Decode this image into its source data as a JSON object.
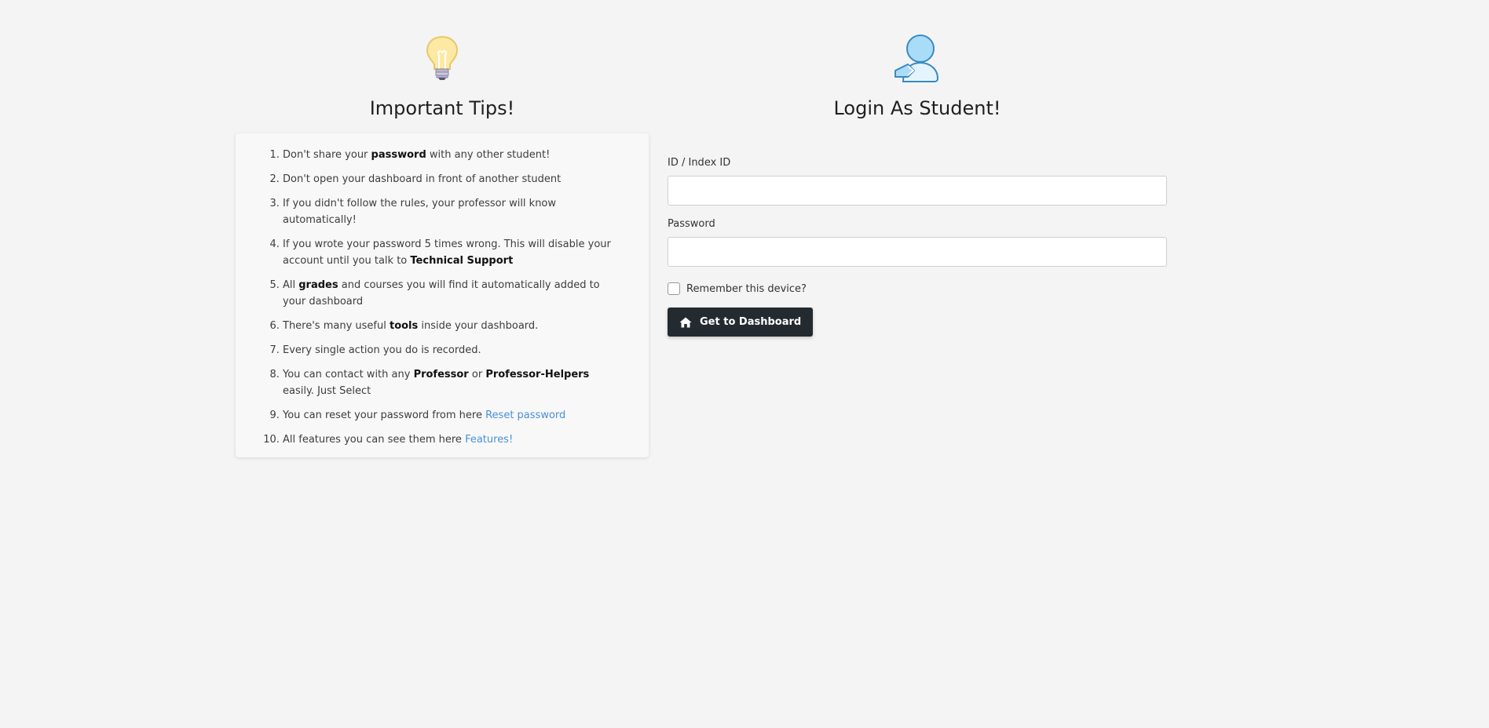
{
  "tips": {
    "title": "Important Tips!",
    "items": [
      {
        "parts": [
          {
            "t": "Don't share your "
          },
          {
            "t": "password",
            "b": true
          },
          {
            "t": " with any other student!"
          }
        ]
      },
      {
        "parts": [
          {
            "t": "Don't open your dashboard in front of another student"
          }
        ]
      },
      {
        "parts": [
          {
            "t": "If you didn't follow the rules, your professor will know automatically!"
          }
        ]
      },
      {
        "parts": [
          {
            "t": "If you wrote your password 5 times wrong. This will disable your account until you talk to "
          },
          {
            "t": "Technical Support",
            "b": true
          }
        ]
      },
      {
        "parts": [
          {
            "t": "All "
          },
          {
            "t": "grades",
            "b": true
          },
          {
            "t": " and courses you will find it automatically added to your dashboard"
          }
        ]
      },
      {
        "parts": [
          {
            "t": "There's many useful "
          },
          {
            "t": "tools",
            "b": true
          },
          {
            "t": " inside your dashboard."
          }
        ]
      },
      {
        "parts": [
          {
            "t": "Every single action you do is recorded."
          }
        ]
      },
      {
        "parts": [
          {
            "t": "You can contact with any "
          },
          {
            "t": "Professor",
            "b": true
          },
          {
            "t": " or "
          },
          {
            "t": "Professor-Helpers",
            "b": true
          },
          {
            "t": " easily. Just Select"
          }
        ]
      },
      {
        "parts": [
          {
            "t": "You can reset your password from here "
          },
          {
            "t": "Reset password",
            "link": true
          }
        ]
      },
      {
        "parts": [
          {
            "t": "All features you can see them here "
          },
          {
            "t": "Features!",
            "link": true
          }
        ]
      }
    ]
  },
  "login": {
    "title": "Login As Student!",
    "id_label": "ID / Index ID",
    "id_value": "",
    "password_label": "Password",
    "password_value": "",
    "remember_label": "Remember this device?",
    "remember_checked": false,
    "submit_label": "Get to Dashboard"
  },
  "icons": {
    "tips_icon": "lightbulb-icon",
    "login_icon": "student-user-icon",
    "button_icon": "home-icon"
  },
  "colors": {
    "background": "#f4f4f4",
    "button": "#232a30",
    "link": "#4a90d9"
  }
}
